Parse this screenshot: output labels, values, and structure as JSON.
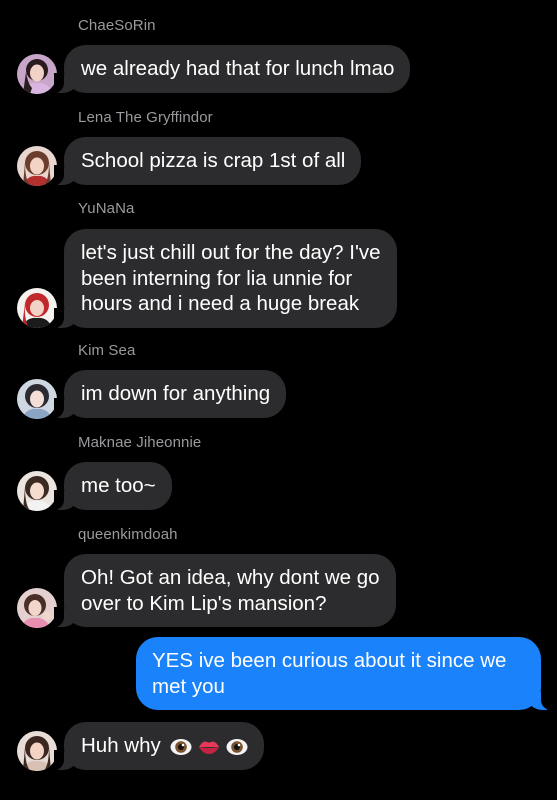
{
  "colors": {
    "background": "#000000",
    "incoming_bubble": "#2c2c2e",
    "outgoing_bubble": "#1a82fb",
    "sender_name": "#9a9a9e",
    "text": "#ffffff"
  },
  "messages": [
    {
      "sender": "ChaeSoRin",
      "text": "we already had that for lunch lmao",
      "direction": "incoming"
    },
    {
      "sender": "Lena The Gryffindor",
      "text": "School pizza is crap 1st of all",
      "direction": "incoming"
    },
    {
      "sender": "YuNaNa",
      "lines": [
        "let's just chill out for the day? I've",
        "been interning for lia unnie for",
        "hours and i need a huge break"
      ],
      "direction": "incoming"
    },
    {
      "sender": "Kim Sea",
      "text": "im down for anything",
      "direction": "incoming"
    },
    {
      "sender": "Maknae Jiheonnie",
      "text": "me too~",
      "direction": "incoming"
    },
    {
      "sender": "queenkimdoah",
      "lines": [
        "Oh! Got an idea, why dont we go",
        "over to Kim Lip's mansion?"
      ],
      "direction": "incoming"
    },
    {
      "sender": "",
      "lines": [
        "YES ive been curious about it since we",
        "met you"
      ],
      "direction": "outgoing"
    },
    {
      "sender": "",
      "text": "Huh why",
      "emojis": [
        "eye-icon",
        "lips-icon",
        "eye-icon"
      ],
      "direction": "incoming"
    }
  ]
}
